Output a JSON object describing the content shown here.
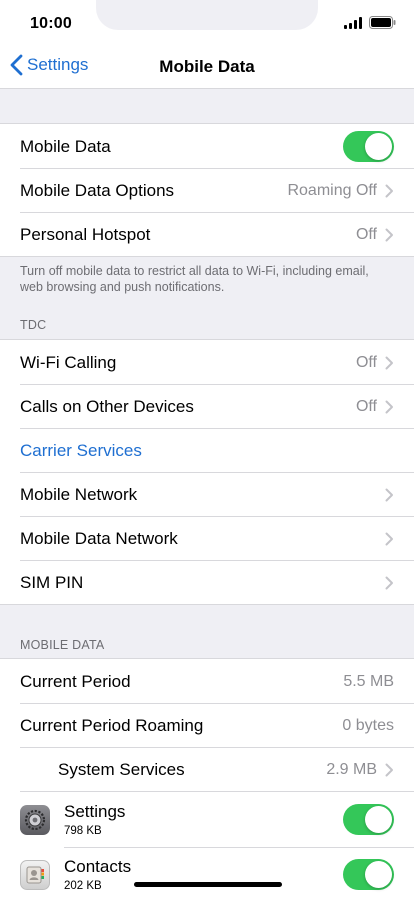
{
  "status": {
    "time": "10:00"
  },
  "nav": {
    "back_label": "Settings",
    "title": "Mobile Data"
  },
  "group1": {
    "mobile_data": {
      "label": "Mobile Data",
      "on": true
    },
    "options": {
      "label": "Mobile Data Options",
      "value": "Roaming Off"
    },
    "hotspot": {
      "label": "Personal Hotspot",
      "value": "Off"
    }
  },
  "footnote": "Turn off mobile data to restrict all data to Wi-Fi, including email, web browsing and push notifications.",
  "carrier_header": "TDC",
  "group2": {
    "wifi_calling": {
      "label": "Wi-Fi Calling",
      "value": "Off"
    },
    "other_devices": {
      "label": "Calls on Other Devices",
      "value": "Off"
    },
    "carrier_services": {
      "label": "Carrier Services"
    },
    "mobile_network": {
      "label": "Mobile Network"
    },
    "mobile_data_network": {
      "label": "Mobile Data Network"
    },
    "sim_pin": {
      "label": "SIM PIN"
    }
  },
  "usage_header": "MOBILE DATA",
  "usage": {
    "current_period": {
      "label": "Current Period",
      "value": "5.5 MB"
    },
    "current_period_roaming": {
      "label": "Current Period Roaming",
      "value": "0 bytes"
    },
    "system_services": {
      "label": "System Services",
      "value": "2.9 MB"
    }
  },
  "apps": [
    {
      "name": "Settings",
      "size": "798 KB",
      "icon": "settings-gear-icon",
      "on": true
    },
    {
      "name": "Contacts",
      "size": "202 KB",
      "icon": "contacts-book-icon",
      "on": true
    }
  ],
  "colors": {
    "accent": "#1f6fd1",
    "toggle_on": "#34c759",
    "background": "#efeff4"
  }
}
